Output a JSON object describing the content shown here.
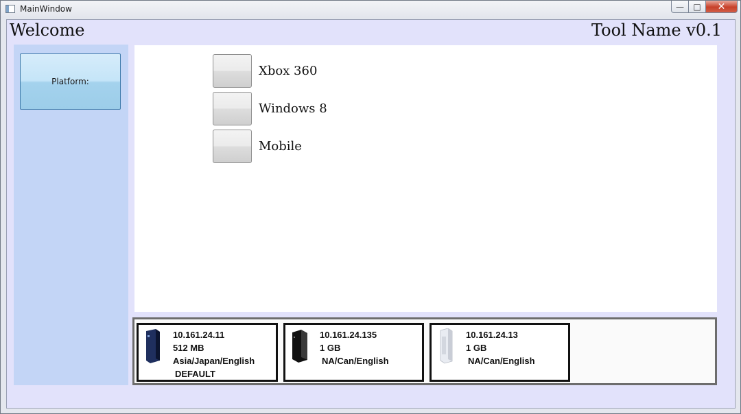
{
  "window": {
    "title": "MainWindow",
    "controls": {
      "minimize": "—",
      "maximize": "□",
      "close": "✕"
    }
  },
  "header": {
    "welcome": "Welcome",
    "tool_name": "Tool Name v0.1"
  },
  "sidebar": {
    "platform_button_label": "Platform:"
  },
  "platform_options": [
    {
      "label": "Xbox 360"
    },
    {
      "label": "Windows 8"
    },
    {
      "label": "Mobile"
    }
  ],
  "devices": [
    {
      "ip": "10.161.24.11",
      "memory": "512 MB",
      "region": "Asia/Japan/English",
      "tag": "DEFAULT",
      "console_color": "#1f2f5e"
    },
    {
      "ip": "10.161.24.135",
      "memory": "1 GB",
      "region": "NA/Can/English",
      "tag": "",
      "console_color": "#111111"
    },
    {
      "ip": "10.161.24.13",
      "memory": "1 GB",
      "region": "NA/Can/English",
      "tag": "",
      "console_color": "#e9ecf2"
    }
  ]
}
